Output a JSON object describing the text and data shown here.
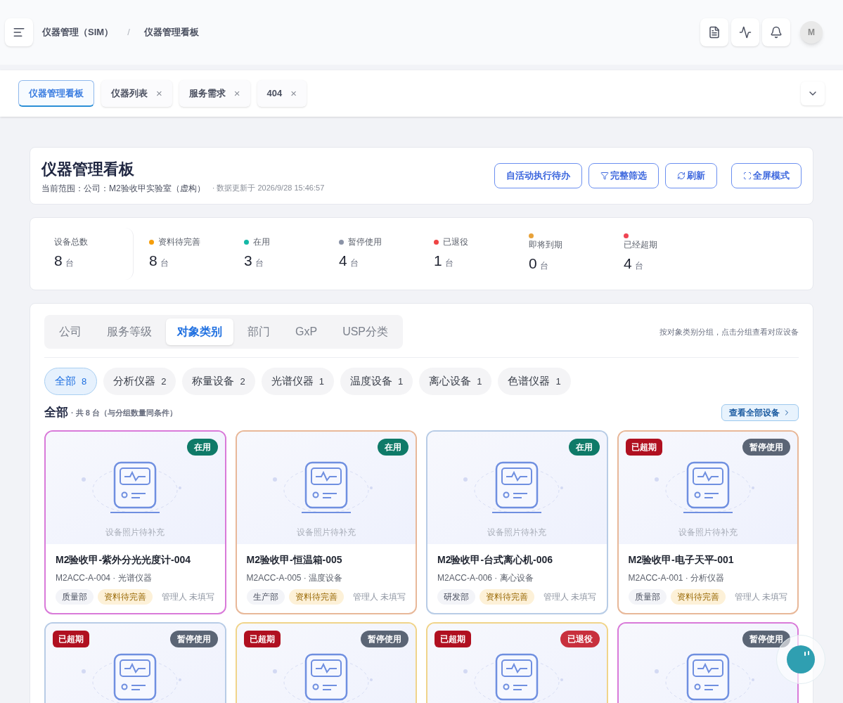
{
  "breadcrumb": [
    "仪器管理（SIM）",
    "/",
    "仪器管理看板"
  ],
  "avatar": "M",
  "tabs": [
    {
      "label": "仪器管理看板",
      "selected": true,
      "closable": false
    },
    {
      "label": "仪器列表",
      "selected": false,
      "closable": true
    },
    {
      "label": "服务需求",
      "selected": false,
      "closable": true
    },
    {
      "label": "404",
      "selected": false,
      "closable": true
    }
  ],
  "close_mark": "×",
  "header": {
    "title": "仪器管理看板",
    "scope": "当前范围：公司：M2验收甲实验室（虚构）",
    "updated": "· 数据更新于 2026/9/28 15:46:57",
    "buttons": [
      {
        "label": "自活动执行待办",
        "kind": "plain"
      },
      {
        "label": "完整筛选",
        "kind": "filter"
      },
      {
        "label": "刷新",
        "kind": "refresh"
      },
      {
        "label": "全屏模式",
        "kind": "fullscreen"
      }
    ]
  },
  "stats": [
    {
      "label": "设备总数",
      "value": "8",
      "unit": "台",
      "kind": "total"
    },
    {
      "label": "资料待完善",
      "value": "8",
      "unit": "台",
      "color": "#f59e0b",
      "kind": "inline"
    },
    {
      "label": "在用",
      "value": "3",
      "unit": "台",
      "color": "#14b8a6",
      "kind": "inline"
    },
    {
      "label": "暂停使用",
      "value": "4",
      "unit": "台",
      "color": "#8b93a7",
      "kind": "inline"
    },
    {
      "label": "已退役",
      "value": "1",
      "unit": "台",
      "color": "#ef4444",
      "kind": "inline"
    },
    {
      "label": "即将到期",
      "value": "0",
      "unit": "台",
      "color": "#e8a23a",
      "kind": "stacked"
    },
    {
      "label": "已经超期",
      "value": "4",
      "unit": "台",
      "color": "#ef4453",
      "kind": "stacked"
    }
  ],
  "group_tabs": [
    {
      "label": "公司",
      "selected": false
    },
    {
      "label": "服务等级",
      "selected": false
    },
    {
      "label": "对象类别",
      "selected": true
    },
    {
      "label": "部门",
      "selected": false
    },
    {
      "label": "GxP",
      "selected": false
    },
    {
      "label": "USP分类",
      "selected": false
    }
  ],
  "group_hint": "按对象类别分组，点击分组查看对应设备",
  "chips": [
    {
      "label": "全部",
      "count": "8",
      "selected": true
    },
    {
      "label": "分析仪器",
      "count": "2",
      "selected": false
    },
    {
      "label": "称量设备",
      "count": "2",
      "selected": false
    },
    {
      "label": "光谱仪器",
      "count": "1",
      "selected": false
    },
    {
      "label": "温度设备",
      "count": "1",
      "selected": false
    },
    {
      "label": "离心设备",
      "count": "1",
      "selected": false
    },
    {
      "label": "色谱仪器",
      "count": "1",
      "selected": false
    }
  ],
  "section": {
    "title": "全部",
    "summary": "· 共 8 台（与分组数量同条件）",
    "view_all": "查看全部设备"
  },
  "cards": [
    {
      "color": "#d97ad9",
      "status": {
        "label": "在用",
        "kind": "in_use"
      },
      "photo_text": "设备照片待补充",
      "name": "M2验收甲-紫外分光光度计-004",
      "meta": "M2ACC-A-004 · 光谱仪器",
      "dept": "质量部",
      "info": "资料待完善",
      "owner": "管理人 未填写"
    },
    {
      "color": "#e8b899",
      "status": {
        "label": "在用",
        "kind": "in_use"
      },
      "photo_text": "设备照片待补充",
      "name": "M2验收甲-恒温箱-005",
      "meta": "M2ACC-A-005 · 温度设备",
      "dept": "生产部",
      "info": "资料待完善",
      "owner": "管理人 未填写"
    },
    {
      "color": "#b8cce6",
      "status": {
        "label": "在用",
        "kind": "in_use"
      },
      "photo_text": "设备照片待补充",
      "name": "M2验收甲-台式离心机-006",
      "meta": "M2ACC-A-006 · 离心设备",
      "dept": "研发部",
      "info": "资料待完善",
      "owner": "管理人 未填写"
    },
    {
      "color": "#e8b899",
      "alert": "已超期",
      "status": {
        "label": "暂停使用",
        "kind": "paused"
      },
      "photo_text": "设备照片待补充",
      "name": "M2验收甲-电子天平-001",
      "meta": "M2ACC-A-001 · 分析仪器",
      "dept": "质量部",
      "info": "资料待完善",
      "owner": "管理人 未填写"
    },
    {
      "color": "#b8cce6",
      "alert": "已超期",
      "status": {
        "label": "暂停使用",
        "kind": "paused"
      }
    },
    {
      "color": "#f0d48a",
      "alert": "已超期",
      "status": {
        "label": "暂停使用",
        "kind": "paused"
      }
    },
    {
      "color": "#f0d48a",
      "alert": "已超期",
      "status": {
        "label": "已退役",
        "kind": "retired"
      }
    },
    {
      "color": "#d97ad9",
      "status": {
        "label": "暂停使用",
        "kind": "paused"
      }
    }
  ]
}
